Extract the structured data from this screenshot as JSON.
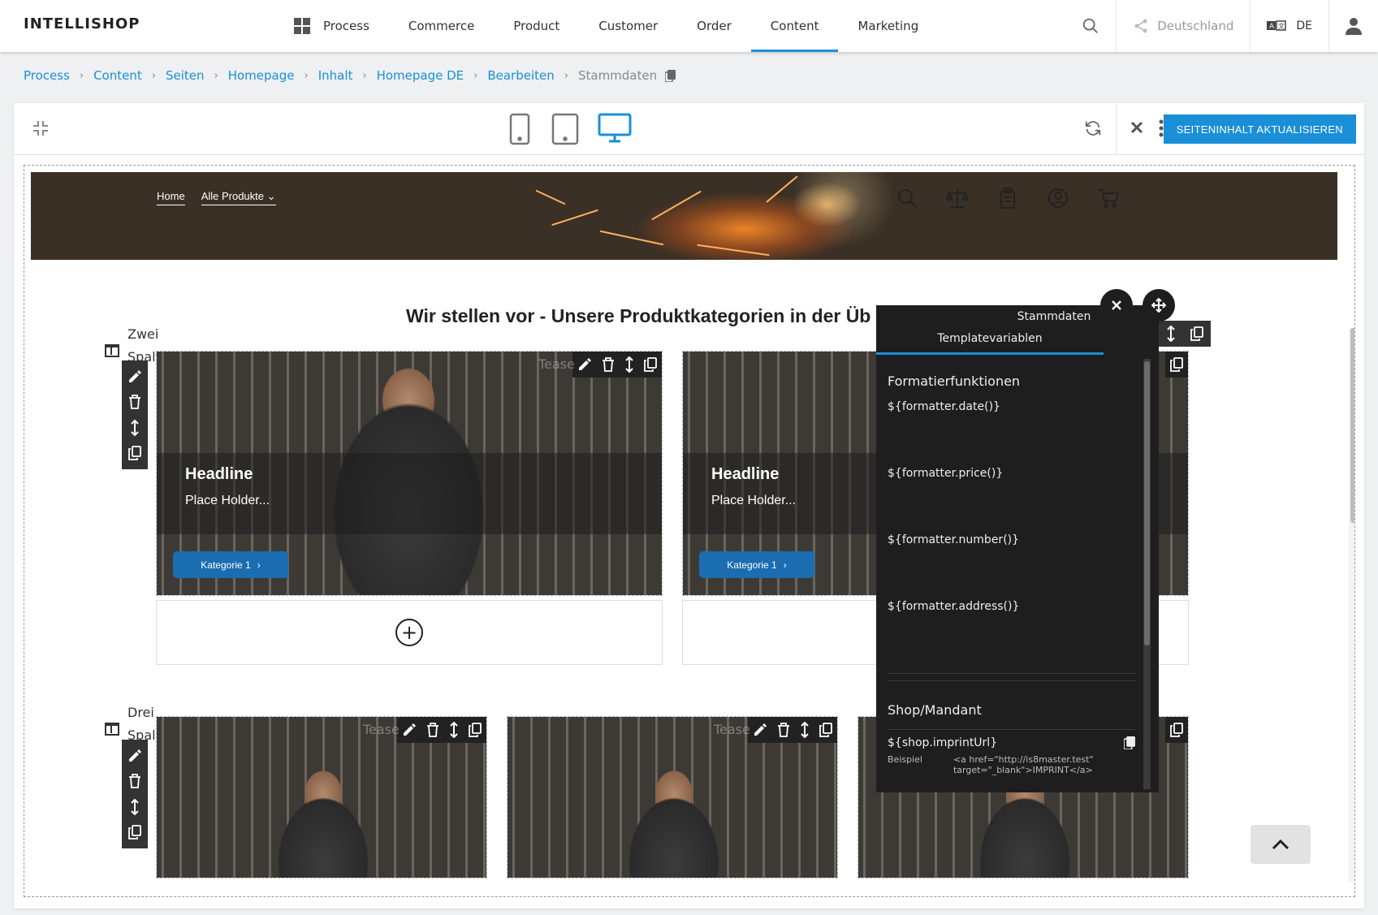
{
  "app": {
    "logo": "INTELLISHOP"
  },
  "nav": {
    "items": [
      "Process",
      "Commerce",
      "Product",
      "Customer",
      "Order",
      "Content",
      "Marketing"
    ],
    "active": "Content"
  },
  "topright": {
    "country": "Deutschland",
    "lang": "DE"
  },
  "breadcrumb": {
    "items": [
      "Process",
      "Content",
      "Seiten",
      "Homepage",
      "Inhalt",
      "Homepage DE",
      "Bearbeiten"
    ],
    "current": "Stammdaten"
  },
  "toolbar": {
    "update_label": "SEITENINHALT AKTUALISIEREN"
  },
  "hero": {
    "nav_home": "Home",
    "nav_products": "Alle Produkte"
  },
  "section": {
    "title": "Wir stellen vor - Unsere Produktkategorien in der Üb"
  },
  "rows": {
    "two": {
      "label_1": "Zwei",
      "label_2": "Spalten"
    },
    "three": {
      "label_1": "Drei",
      "label_2": "Spalten"
    }
  },
  "teaser": {
    "ghost": "Tease",
    "headline": "Headline",
    "placeholder": "Place Holder...",
    "button": "Kategorie 1"
  },
  "panel": {
    "title": "Stammdaten",
    "tab": "Templatevariablen",
    "section1": "Formatierfunktionen",
    "vars": [
      "${formatter.date()}",
      "${formatter.price()}",
      "${formatter.number()}",
      "${formatter.address()}"
    ],
    "section2": "Shop/Mandant",
    "shop_var": "${shop.imprintUrl}",
    "example_label": "Beispiel",
    "example_value": "<a href=\"http://is8master.test\" target=\"_blank\">IMPRINT</a>"
  },
  "colors": {
    "accent": "#1a8fd8",
    "button": "#1a6db0",
    "panel_bg": "#1e1e1e"
  }
}
